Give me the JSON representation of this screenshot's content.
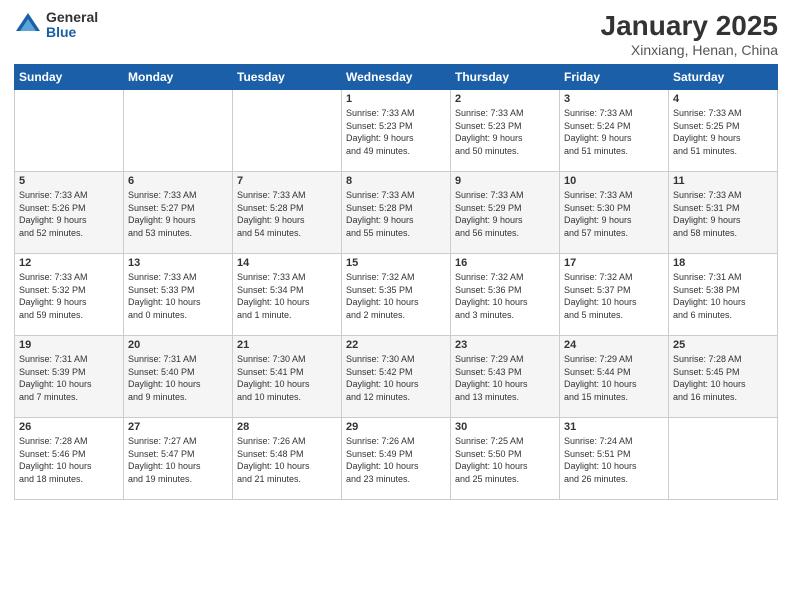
{
  "logo": {
    "general": "General",
    "blue": "Blue"
  },
  "header": {
    "title": "January 2025",
    "subtitle": "Xinxiang, Henan, China"
  },
  "days_of_week": [
    "Sunday",
    "Monday",
    "Tuesday",
    "Wednesday",
    "Thursday",
    "Friday",
    "Saturday"
  ],
  "weeks": [
    [
      {
        "day": "",
        "info": ""
      },
      {
        "day": "",
        "info": ""
      },
      {
        "day": "",
        "info": ""
      },
      {
        "day": "1",
        "info": "Sunrise: 7:33 AM\nSunset: 5:23 PM\nDaylight: 9 hours\nand 49 minutes."
      },
      {
        "day": "2",
        "info": "Sunrise: 7:33 AM\nSunset: 5:23 PM\nDaylight: 9 hours\nand 50 minutes."
      },
      {
        "day": "3",
        "info": "Sunrise: 7:33 AM\nSunset: 5:24 PM\nDaylight: 9 hours\nand 51 minutes."
      },
      {
        "day": "4",
        "info": "Sunrise: 7:33 AM\nSunset: 5:25 PM\nDaylight: 9 hours\nand 51 minutes."
      }
    ],
    [
      {
        "day": "5",
        "info": "Sunrise: 7:33 AM\nSunset: 5:26 PM\nDaylight: 9 hours\nand 52 minutes."
      },
      {
        "day": "6",
        "info": "Sunrise: 7:33 AM\nSunset: 5:27 PM\nDaylight: 9 hours\nand 53 minutes."
      },
      {
        "day": "7",
        "info": "Sunrise: 7:33 AM\nSunset: 5:28 PM\nDaylight: 9 hours\nand 54 minutes."
      },
      {
        "day": "8",
        "info": "Sunrise: 7:33 AM\nSunset: 5:28 PM\nDaylight: 9 hours\nand 55 minutes."
      },
      {
        "day": "9",
        "info": "Sunrise: 7:33 AM\nSunset: 5:29 PM\nDaylight: 9 hours\nand 56 minutes."
      },
      {
        "day": "10",
        "info": "Sunrise: 7:33 AM\nSunset: 5:30 PM\nDaylight: 9 hours\nand 57 minutes."
      },
      {
        "day": "11",
        "info": "Sunrise: 7:33 AM\nSunset: 5:31 PM\nDaylight: 9 hours\nand 58 minutes."
      }
    ],
    [
      {
        "day": "12",
        "info": "Sunrise: 7:33 AM\nSunset: 5:32 PM\nDaylight: 9 hours\nand 59 minutes."
      },
      {
        "day": "13",
        "info": "Sunrise: 7:33 AM\nSunset: 5:33 PM\nDaylight: 10 hours\nand 0 minutes."
      },
      {
        "day": "14",
        "info": "Sunrise: 7:33 AM\nSunset: 5:34 PM\nDaylight: 10 hours\nand 1 minute."
      },
      {
        "day": "15",
        "info": "Sunrise: 7:32 AM\nSunset: 5:35 PM\nDaylight: 10 hours\nand 2 minutes."
      },
      {
        "day": "16",
        "info": "Sunrise: 7:32 AM\nSunset: 5:36 PM\nDaylight: 10 hours\nand 3 minutes."
      },
      {
        "day": "17",
        "info": "Sunrise: 7:32 AM\nSunset: 5:37 PM\nDaylight: 10 hours\nand 5 minutes."
      },
      {
        "day": "18",
        "info": "Sunrise: 7:31 AM\nSunset: 5:38 PM\nDaylight: 10 hours\nand 6 minutes."
      }
    ],
    [
      {
        "day": "19",
        "info": "Sunrise: 7:31 AM\nSunset: 5:39 PM\nDaylight: 10 hours\nand 7 minutes."
      },
      {
        "day": "20",
        "info": "Sunrise: 7:31 AM\nSunset: 5:40 PM\nDaylight: 10 hours\nand 9 minutes."
      },
      {
        "day": "21",
        "info": "Sunrise: 7:30 AM\nSunset: 5:41 PM\nDaylight: 10 hours\nand 10 minutes."
      },
      {
        "day": "22",
        "info": "Sunrise: 7:30 AM\nSunset: 5:42 PM\nDaylight: 10 hours\nand 12 minutes."
      },
      {
        "day": "23",
        "info": "Sunrise: 7:29 AM\nSunset: 5:43 PM\nDaylight: 10 hours\nand 13 minutes."
      },
      {
        "day": "24",
        "info": "Sunrise: 7:29 AM\nSunset: 5:44 PM\nDaylight: 10 hours\nand 15 minutes."
      },
      {
        "day": "25",
        "info": "Sunrise: 7:28 AM\nSunset: 5:45 PM\nDaylight: 10 hours\nand 16 minutes."
      }
    ],
    [
      {
        "day": "26",
        "info": "Sunrise: 7:28 AM\nSunset: 5:46 PM\nDaylight: 10 hours\nand 18 minutes."
      },
      {
        "day": "27",
        "info": "Sunrise: 7:27 AM\nSunset: 5:47 PM\nDaylight: 10 hours\nand 19 minutes."
      },
      {
        "day": "28",
        "info": "Sunrise: 7:26 AM\nSunset: 5:48 PM\nDaylight: 10 hours\nand 21 minutes."
      },
      {
        "day": "29",
        "info": "Sunrise: 7:26 AM\nSunset: 5:49 PM\nDaylight: 10 hours\nand 23 minutes."
      },
      {
        "day": "30",
        "info": "Sunrise: 7:25 AM\nSunset: 5:50 PM\nDaylight: 10 hours\nand 25 minutes."
      },
      {
        "day": "31",
        "info": "Sunrise: 7:24 AM\nSunset: 5:51 PM\nDaylight: 10 hours\nand 26 minutes."
      },
      {
        "day": "",
        "info": ""
      }
    ]
  ]
}
